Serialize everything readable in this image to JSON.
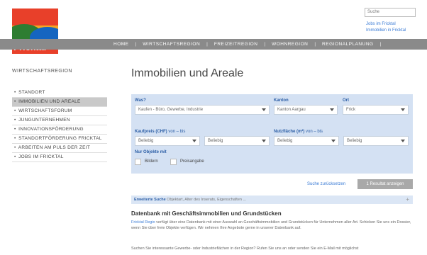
{
  "logo": {
    "word": "Fricktal"
  },
  "header": {
    "search_placeholder": "Suche",
    "links": [
      "Jobs im Fricktal",
      "Immobilien in Fricktal"
    ]
  },
  "nav": {
    "items": [
      "HOME",
      "WIRTSCHAFTSREGION",
      "FREIZEITREGION",
      "WOHNREGION",
      "REGIONALPLANUNG"
    ],
    "separator": "|"
  },
  "sidebar": {
    "title": "WIRTSCHAFTSREGION",
    "bullet": "•",
    "items": [
      {
        "label": "STANDORT",
        "active": false
      },
      {
        "label": "IMMOBILIEN UND AREALE",
        "active": true
      },
      {
        "label": "WIRTSCHAFTSFORUM",
        "active": false
      },
      {
        "label": "JUNGUNTERNEHMEN",
        "active": false
      },
      {
        "label": "INNOVATIONSFÖRDERUNG",
        "active": false
      },
      {
        "label": "STANDORTFÖRDERUNG FRICKTAL",
        "active": false
      },
      {
        "label": "ARBEITEN AM PULS DER ZEIT",
        "active": false
      },
      {
        "label": "JOBS IM FRICKTAL",
        "active": false
      }
    ]
  },
  "main": {
    "title": "Immobilien und Areale",
    "filters": {
      "was_label": "Was?",
      "was_value": "Kaufen - Büro, Gewerbe, Industrie",
      "kanton_label": "Kanton",
      "kanton_value": "Kanton Aargau",
      "ort_label": "Ort",
      "ort_value": "Frick",
      "kaufpreis_label": "Kaufpreis (CHF)",
      "kaufpreis_suffix": "von – bis",
      "kaufpreis_from": "Beliebig",
      "kaufpreis_to": "Beliebig",
      "nutzflaeche_label": "Nutzfläche (m²)",
      "nutzflaeche_suffix": "von – bis",
      "nutzflaeche_from": "Beliebig",
      "nutzflaeche_to": "Beliebig",
      "nur_objekte_label": "Nur Objekte mit",
      "checkbox_bildern": "Bildern",
      "checkbox_preisangabe": "Preisangabe"
    },
    "reset_link": "Suche zurücksetzen",
    "result_button": "1 Resultat anzeigen",
    "advanced_search": {
      "strong": "Erweiterte Suche",
      "hint": "Objektart, Alter des Inserats, Eigenschaften ...",
      "plus": "+"
    },
    "database": {
      "title": "Datenbank mit Geschäftsimmobilien und Grundstücken",
      "link": "Fricktal Regio",
      "text1": "verfügt über eine Datenbank mit einer Auswahl an Geschäftsimmobilien und Grundstücken für Unternehmen aller Art. Schicken Sie uns ein Dossier, wenn Sie über freie Objekte verfügen. Wir nehmen Ihre Angebote gerne in unserer Datenbank auf.",
      "text2": "Suchen Sie interessante Gewerbe- oder Industrieflächen in der Region? Rufen Sie uns an oder senden Sie ein E-Mail mit möglichst"
    }
  }
}
